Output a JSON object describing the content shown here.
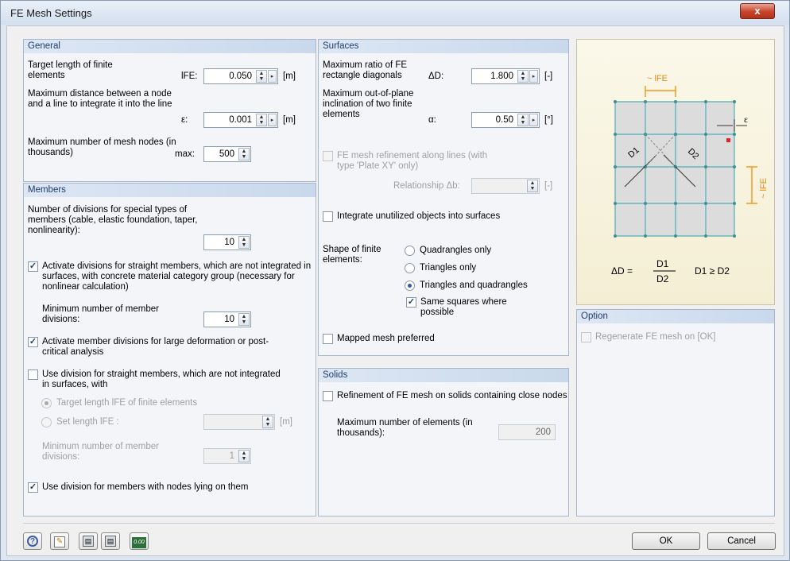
{
  "window": {
    "title": "FE Mesh Settings",
    "close_glyph": "x"
  },
  "general": {
    "header": "General",
    "target_length": {
      "label": "Target length of finite elements",
      "symbol": "lFE:",
      "value": "0.050",
      "unit": "[m]"
    },
    "max_distance": {
      "label": "Maximum distance between a node and a line to integrate it into the line",
      "symbol": "ε:",
      "value": "0.001",
      "unit": "[m]"
    },
    "max_nodes": {
      "label": "Maximum number of mesh nodes (in thousands)",
      "symbol": "max:",
      "value": "500"
    }
  },
  "members": {
    "header": "Members",
    "special_divisions": {
      "label": "Number of divisions for special types of members (cable, elastic foundation, taper, nonlinearity):",
      "value": "10"
    },
    "activate_straight": {
      "label": "Activate divisions for straight members, which are not integrated in surfaces, with concrete material category group (necessary for nonlinear calculation)",
      "checked": true
    },
    "min_divisions": {
      "label": "Minimum number of member divisions:",
      "value": "10"
    },
    "activate_large": {
      "label": "Activate member divisions for large deformation or post-critical analysis",
      "checked": true
    },
    "use_division": {
      "label": "Use division for straight members, which are not integrated in surfaces, with",
      "checked": false
    },
    "radio_target": {
      "label": "Target length lFE of finite elements",
      "checked": true
    },
    "radio_set": {
      "label": "Set length lFE :",
      "unit": "[m]"
    },
    "min_divisions_2": {
      "label": "Minimum number of member divisions:",
      "value": "1"
    },
    "nodes_lying": {
      "label": "Use division for members with nodes lying on them",
      "checked": true
    }
  },
  "surfaces": {
    "header": "Surfaces",
    "max_ratio": {
      "label": "Maximum ratio of FE rectangle diagonals",
      "symbol": "ΔD:",
      "value": "1.800",
      "unit": "[-]"
    },
    "max_incl": {
      "label": "Maximum out-of-plane inclination of two finite elements",
      "symbol": "α:",
      "value": "0.50",
      "unit": "[°]"
    },
    "refinement": {
      "label": "FE mesh refinement along lines (with type 'Plate XY' only)",
      "checked": false
    },
    "relationship": {
      "label": "Relationship Δb:",
      "unit": "[-]"
    },
    "integrate": {
      "label": "Integrate unutilized objects into surfaces",
      "checked": false
    },
    "shape_label": "Shape of finite elements:",
    "shape_options": [
      "Quadrangles only",
      "Triangles only",
      "Triangles and quadrangles"
    ],
    "shape_selected": 2,
    "same_squares": {
      "label": "Same squares where possible",
      "checked": true
    },
    "mapped": {
      "label": "Mapped mesh preferred",
      "checked": false
    }
  },
  "solids": {
    "header": "Solids",
    "refinement": {
      "label": "Refinement of FE mesh on solids containing close nodes",
      "checked": false
    },
    "max_elements": {
      "label": "Maximum number of elements (in thousands):",
      "value": "200"
    }
  },
  "diagram": {
    "lfe_top": "~ lFE",
    "lfe_side": "~ lFE",
    "epsilon": "ε",
    "d1": "D1",
    "d2": "D2",
    "formula_lhs": "ΔD =",
    "formula_num": "D1",
    "formula_den": "D2",
    "formula_cond": "D1 ≥ D2"
  },
  "option": {
    "header": "Option",
    "regenerate": {
      "label": "Regenerate FE mesh on [OK]",
      "checked": false
    }
  },
  "footer": {
    "ok": "OK",
    "cancel": "Cancel",
    "num_btn": "0.00"
  },
  "colors": {
    "mesh_line": "#4bb0b8",
    "dimension": "#f29a1c",
    "node": "#3f8f8f"
  }
}
